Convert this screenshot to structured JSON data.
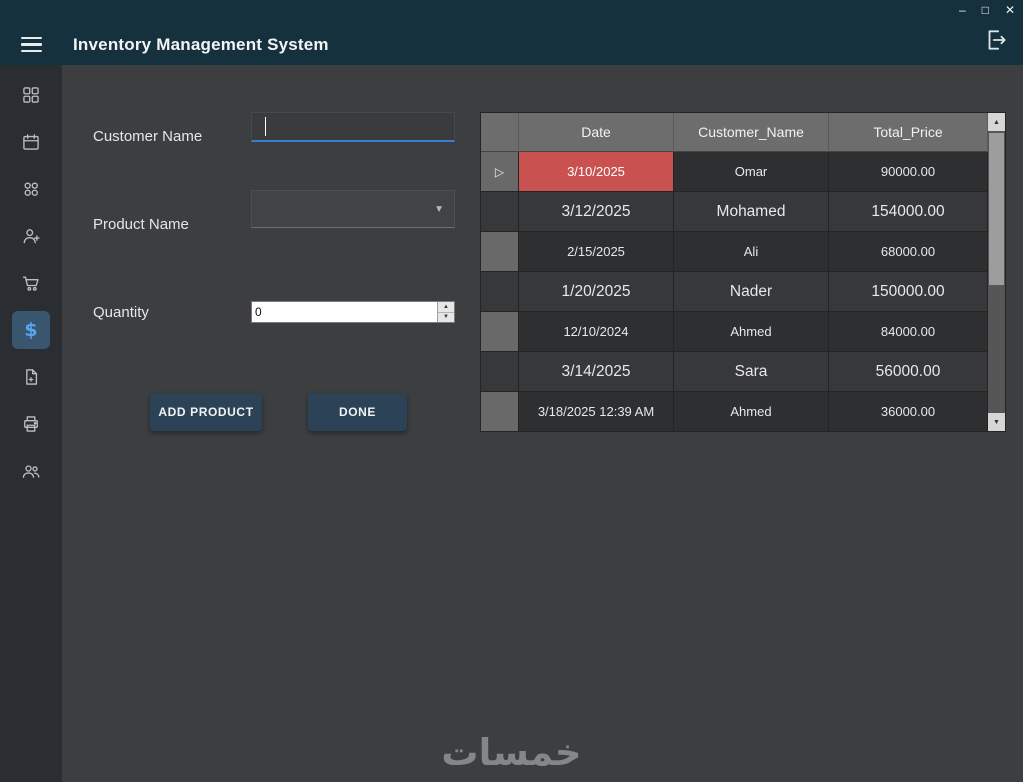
{
  "window": {
    "controls": {
      "minimize": "–",
      "maximize": "□",
      "close": "✕"
    }
  },
  "header": {
    "title": "Inventory Management System"
  },
  "sidebar": {
    "items": [
      "dashboard",
      "calendar",
      "contacts",
      "person-edit",
      "cart",
      "sales",
      "document",
      "printer",
      "customers"
    ],
    "selected": "sales",
    "dollar_glyph": "$"
  },
  "form": {
    "customer_name": {
      "label": "Customer Name",
      "value": ""
    },
    "product_name": {
      "label": "Product Name",
      "value": ""
    },
    "quantity": {
      "label": "Quantity",
      "value": "0"
    },
    "buttons": {
      "add_product": "ADD PRODUCT",
      "done": "DONE"
    }
  },
  "grid": {
    "columns": [
      "Date",
      "Customer_Name",
      "Total_Price"
    ],
    "rows": [
      {
        "date": "3/10/2025",
        "customer": "Omar",
        "total": "90000.00",
        "selected": true
      },
      {
        "date": "3/12/2025",
        "customer": "Mohamed",
        "total": "154000.00",
        "selected": false
      },
      {
        "date": "2/15/2025",
        "customer": "Ali",
        "total": "68000.00",
        "selected": false
      },
      {
        "date": "1/20/2025",
        "customer": "Nader",
        "total": "150000.00",
        "selected": false
      },
      {
        "date": "12/10/2024",
        "customer": "Ahmed",
        "total": "84000.00",
        "selected": false
      },
      {
        "date": "3/14/2025",
        "customer": "Sara",
        "total": "56000.00",
        "selected": false
      },
      {
        "date": "3/18/2025 12:39 AM",
        "customer": "Ahmed",
        "total": "36000.00",
        "selected": false
      }
    ],
    "selected_cell": {
      "row": 0,
      "column": "Date"
    }
  },
  "watermark": "خمسات",
  "colors": {
    "titlebar": "#16313e",
    "sidebar": "#2a2d31",
    "background": "#3d3e40",
    "accent": "#3a7bd5",
    "selection_red": "#c95250",
    "button": "#2c4257",
    "grid_header": "#6d6d6d",
    "sidebar_selected": "#3a566f"
  }
}
